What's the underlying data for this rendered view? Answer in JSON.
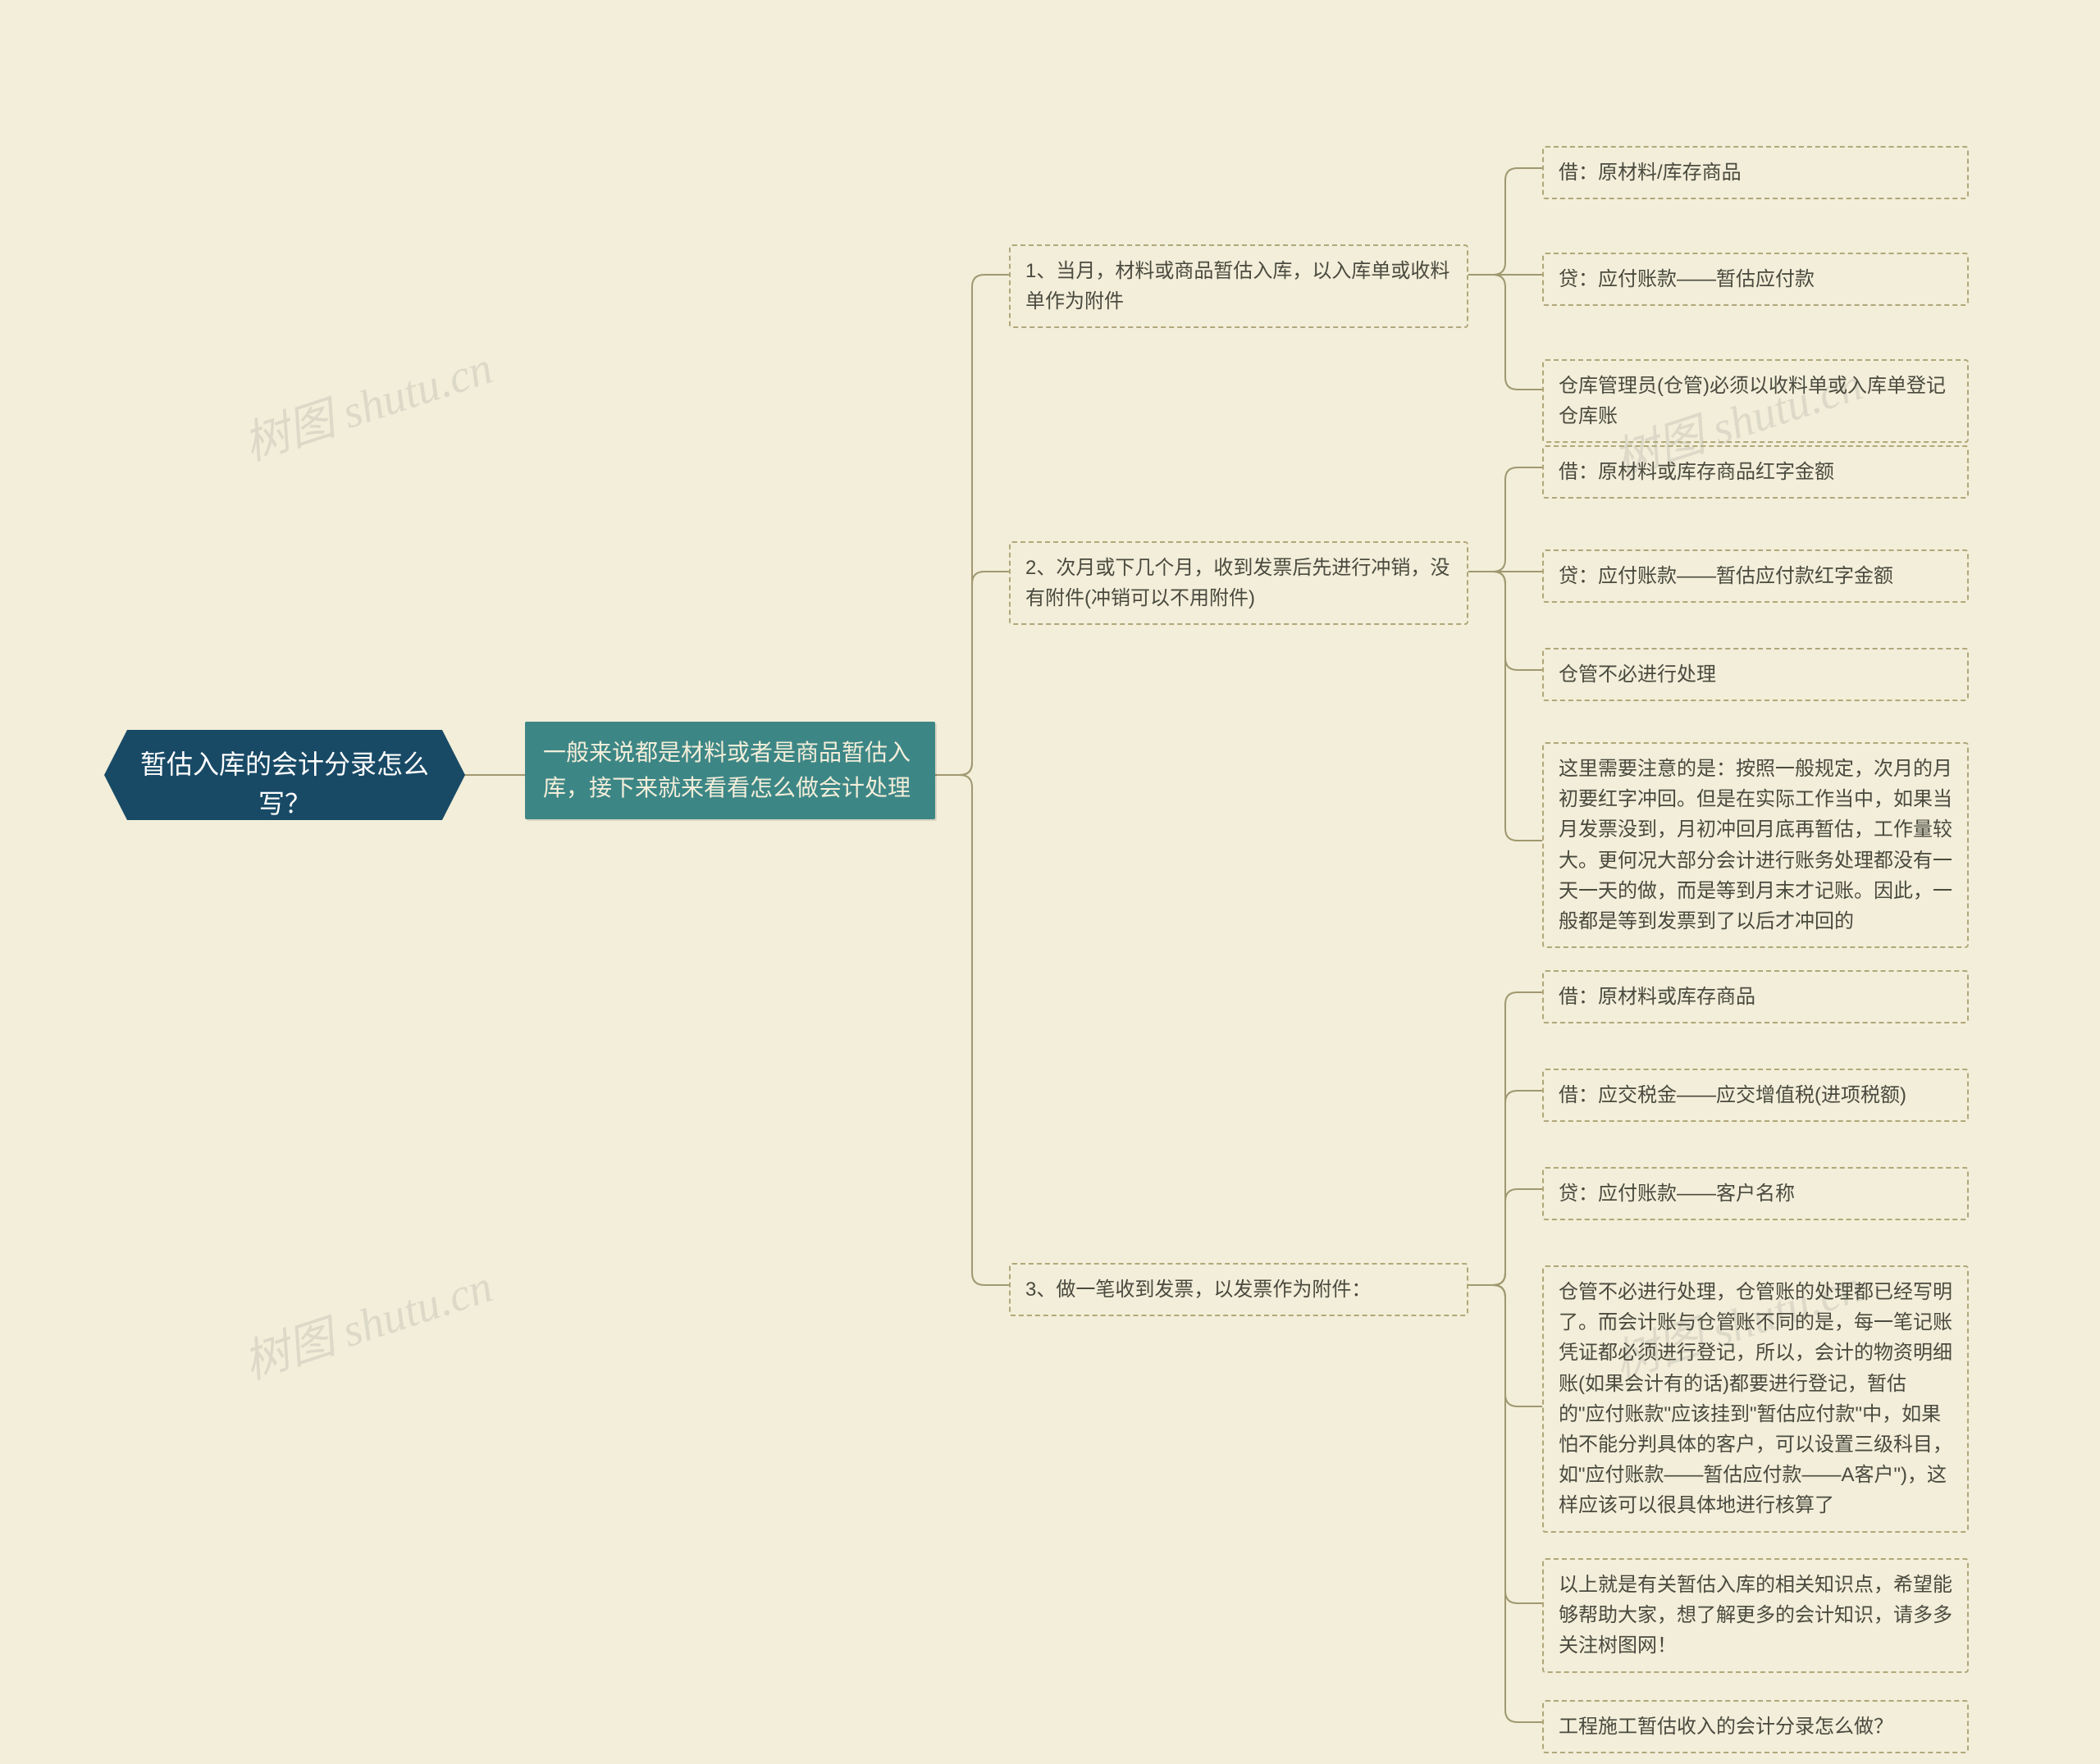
{
  "watermark_text": "树图 shutu.cn",
  "root": {
    "title": "暂估入库的会计分录怎么写？"
  },
  "sub": {
    "text": "一般来说都是材料或者是商品暂估入库，接下来就来看看怎么做会计处理"
  },
  "branch1": {
    "title": "1、当月，材料或商品暂估入库，以入库单或收料单作为附件",
    "leaves": {
      "a": "借：原材料/库存商品",
      "b": "贷：应付账款——暂估应付款",
      "c": "仓库管理员(仓管)必须以收料单或入库单登记仓库账"
    }
  },
  "branch2": {
    "title": "2、次月或下几个月，收到发票后先进行冲销，没有附件(冲销可以不用附件)",
    "leaves": {
      "a": "借：原材料或库存商品红字金额",
      "b": "贷：应付账款——暂估应付款红字金额",
      "c": "仓管不必进行处理",
      "d": "这里需要注意的是：按照一般规定，次月的月初要红字冲回。但是在实际工作当中，如果当月发票没到，月初冲回月底再暂估，工作量较大。更何况大部分会计进行账务处理都没有一天一天的做，而是等到月末才记账。因此，一般都是等到发票到了以后才冲回的"
    }
  },
  "branch3": {
    "title": "3、做一笔收到发票，以发票作为附件：",
    "leaves": {
      "a": "借：原材料或库存商品",
      "b": "借：应交税金——应交增值税(进项税额)",
      "c": "贷：应付账款——客户名称",
      "d": "仓管不必进行处理，仓管账的处理都已经写明了。而会计账与仓管账不同的是，每一笔记账凭证都必须进行登记，所以，会计的物资明细账(如果会计有的话)都要进行登记，暂估的\"应付账款\"应该挂到\"暂估应付款\"中，如果怕不能分判具体的客户，可以设置三级科目，如\"应付账款——暂估应付款——A客户\")，这样应该可以很具体地进行核算了",
      "e": "以上就是有关暂估入库的相关知识点，希望能够帮助大家，想了解更多的会计知识，请多多关注树图网！",
      "f": "工程施工暂估收入的会计分录怎么做？"
    }
  }
}
